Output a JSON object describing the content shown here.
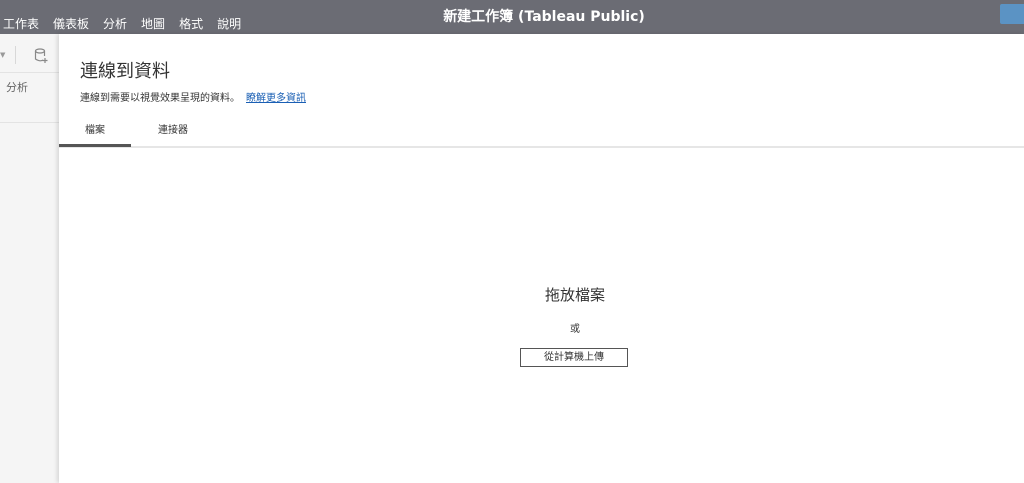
{
  "app_title": "新建工作簿 (Tableau Public)",
  "menu": [
    "工作表",
    "儀表板",
    "分析",
    "地圖",
    "格式",
    "說明"
  ],
  "left_panel": {
    "section_label": "分析"
  },
  "dialog": {
    "title": "連線到資料",
    "subtitle": "連線到需要以視覺效果呈現的資料。",
    "learn_more": "瞭解更多資訊",
    "tabs": [
      "檔案",
      "連接器"
    ],
    "active_tab": "檔案",
    "drop_text": "拖放檔案",
    "or_text": "或",
    "upload_button": "從計算機上傳"
  },
  "colors": {
    "topbar": "#6b6c74",
    "accent_button": "#5b93c4",
    "link": "#1a5fb4"
  }
}
